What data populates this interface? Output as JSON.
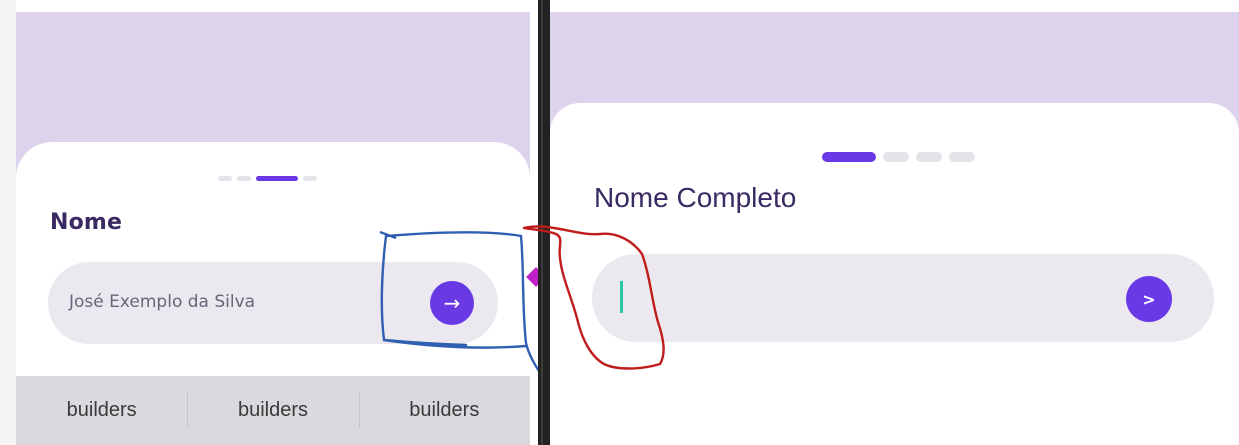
{
  "left": {
    "label": "Nome",
    "input_value": "José Exemplo da Silva",
    "submit_icon": "arrow-right-icon",
    "submit_glyph": "→",
    "tabs": [
      "builders",
      "builders",
      "builders"
    ],
    "progress": {
      "steps": 4,
      "active": 3
    }
  },
  "right": {
    "label": "Nome Completo",
    "input_value": "",
    "submit_icon": "chevron-right-icon",
    "submit_glyph": ">",
    "progress": {
      "steps": 4,
      "active": 1
    }
  },
  "colors": {
    "accent": "#6a39e6",
    "header_lavender": "#ded3ec",
    "input_bg": "#ece8ef",
    "title_text": "#3a2a63",
    "blue_annotation": "#2f5fb0",
    "red_annotation": "#c01c1c",
    "caret": "#2cc7a6"
  }
}
